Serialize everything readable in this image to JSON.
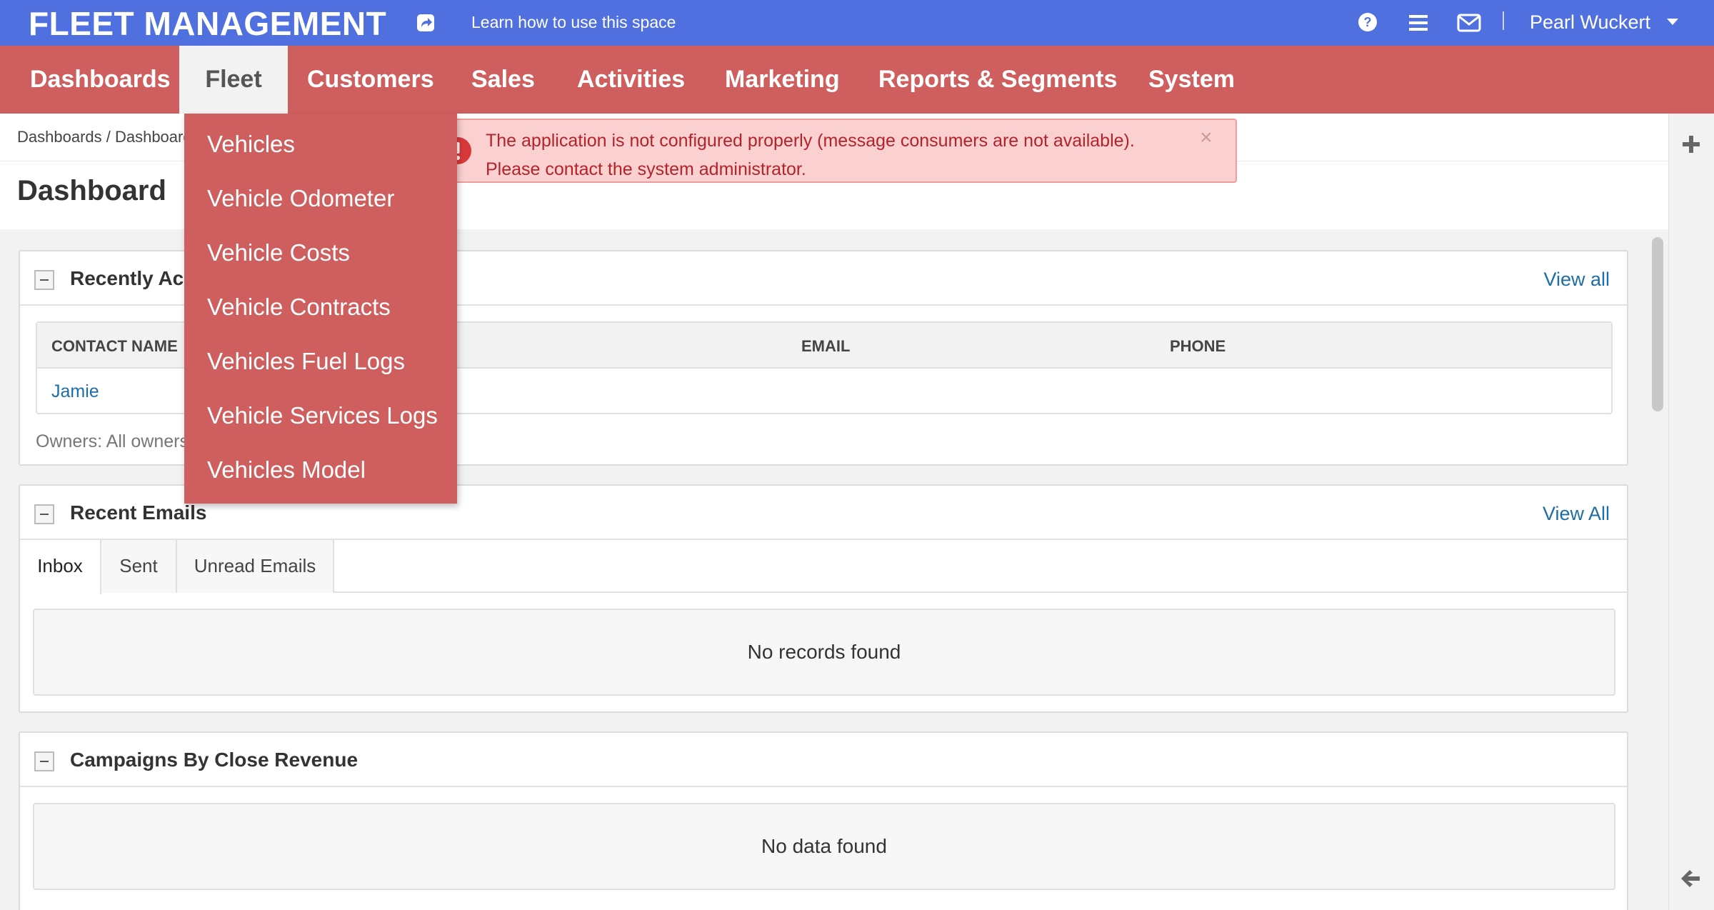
{
  "topbar": {
    "app_title": "FLEET MANAGEMENT",
    "learn_link": "Learn how to use this space",
    "user_name": "Pearl Wuckert"
  },
  "nav": {
    "items": [
      "Dashboards",
      "Fleet",
      "Customers",
      "Sales",
      "Activities",
      "Marketing",
      "Reports & Segments",
      "System"
    ],
    "active": "Fleet"
  },
  "fleet_menu": {
    "items": [
      "Vehicles",
      "Vehicle Odometer",
      "Vehicle Costs",
      "Vehicle Contracts",
      "Vehicles Fuel Logs",
      "Vehicle Services Logs",
      "Vehicles Model"
    ]
  },
  "breadcrumb": "Dashboards / Dashboard",
  "page_title": "Dashboard",
  "alert": {
    "line1": "The application is not configured properly (message consumers are not available).",
    "line2": "Please contact the system administrator.",
    "close": "×"
  },
  "widgets": {
    "recent_contacts": {
      "title": "Recently Accessed Contacts",
      "link": "View all",
      "columns": [
        "CONTACT NAME",
        "EMAIL",
        "PHONE"
      ],
      "rows": [
        [
          "Jamie",
          "",
          ""
        ]
      ],
      "footer": "Owners: All owners"
    },
    "recent_emails": {
      "title": "Recent Emails",
      "link": "View All",
      "tabs": [
        "Inbox",
        "Sent",
        "Unread Emails"
      ],
      "active_tab": "Inbox",
      "empty": "No records found"
    },
    "campaigns": {
      "title": "Campaigns By Close Revenue",
      "empty": "No data found"
    }
  },
  "colors": {
    "topbar": "#5170e0",
    "navbar": "#cf5f5e",
    "link": "#1d6da7",
    "alert_bg": "#fbd0d0",
    "alert_text": "#b4232a"
  }
}
